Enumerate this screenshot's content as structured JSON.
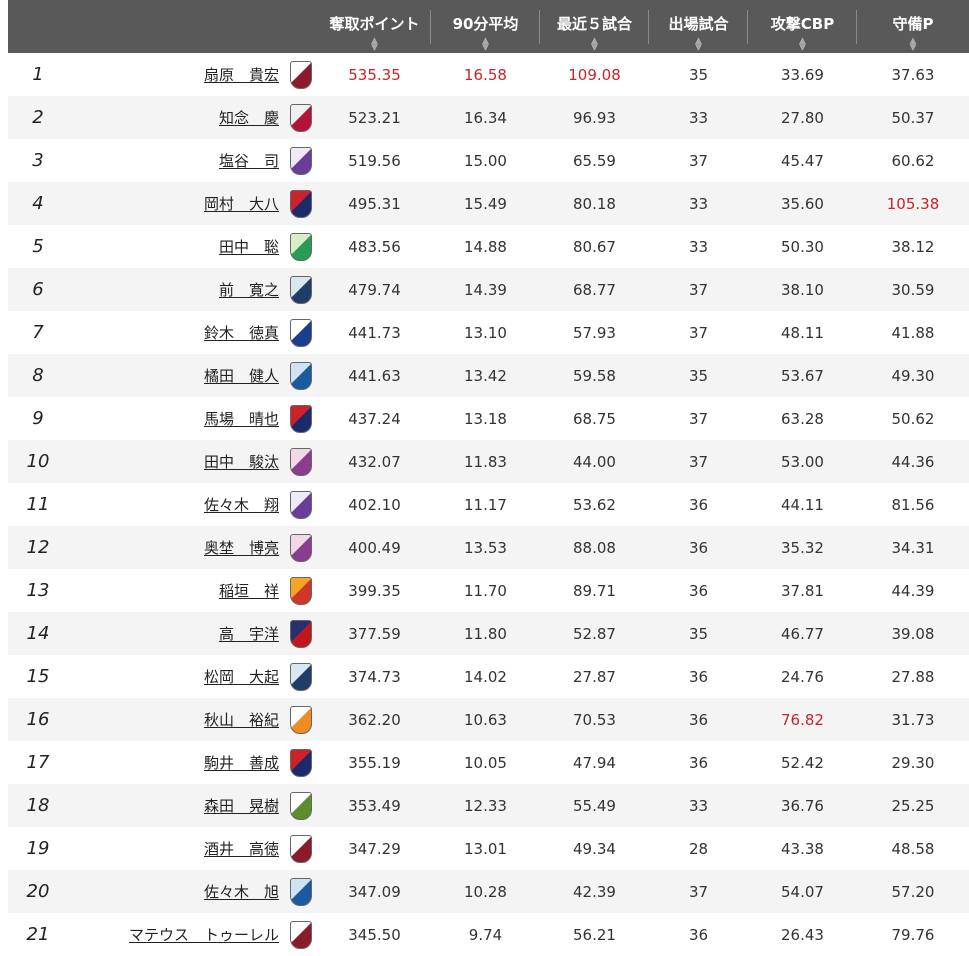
{
  "header": {
    "columns": [
      "奪取ポイント",
      "90分平均",
      "最近５試合",
      "出場試合",
      "攻撃CBP",
      "守備P"
    ],
    "sort_icon": "sort-arrows-icon"
  },
  "colors": {
    "header_bg": "#595959",
    "highlight": "#c8242b",
    "alt_row": "#f4f4f4"
  },
  "rows": [
    {
      "rank": "1",
      "name": "扇原　貴宏",
      "crest": "vissel",
      "v1": "535.35",
      "v2": "16.58",
      "v3": "109.08",
      "v4": "35",
      "v5": "33.69",
      "v6": "37.63"
    },
    {
      "rank": "2",
      "name": "知念　慶",
      "crest": "kashima",
      "v1": "523.21",
      "v2": "16.34",
      "v3": "96.93",
      "v4": "33",
      "v5": "27.80",
      "v6": "50.37"
    },
    {
      "rank": "3",
      "name": "塩谷　司",
      "crest": "hiroshima",
      "v1": "519.56",
      "v2": "15.00",
      "v3": "65.59",
      "v4": "37",
      "v5": "45.47",
      "v6": "60.62"
    },
    {
      "rank": "4",
      "name": "岡村　大八",
      "crest": "sapporo",
      "v1": "495.31",
      "v2": "15.49",
      "v3": "80.18",
      "v4": "33",
      "v5": "35.60",
      "v6": "105.38"
    },
    {
      "rank": "5",
      "name": "田中　聡",
      "crest": "shonan",
      "v1": "483.56",
      "v2": "14.88",
      "v3": "80.67",
      "v4": "33",
      "v5": "50.30",
      "v6": "38.12"
    },
    {
      "rank": "6",
      "name": "前　寛之",
      "crest": "fukuoka",
      "v1": "479.74",
      "v2": "14.39",
      "v3": "68.77",
      "v4": "37",
      "v5": "38.10",
      "v6": "30.59"
    },
    {
      "rank": "7",
      "name": "鈴木　徳真",
      "crest": "gamba",
      "v1": "441.73",
      "v2": "13.10",
      "v3": "57.93",
      "v4": "37",
      "v5": "48.11",
      "v6": "41.88"
    },
    {
      "rank": "8",
      "name": "橘田　健人",
      "crest": "kawasaki",
      "v1": "441.63",
      "v2": "13.42",
      "v3": "59.58",
      "v4": "35",
      "v5": "53.67",
      "v6": "49.30"
    },
    {
      "rank": "9",
      "name": "馬場　晴也",
      "crest": "sapporo",
      "v1": "437.24",
      "v2": "13.18",
      "v3": "68.75",
      "v4": "37",
      "v5": "63.28",
      "v6": "50.62"
    },
    {
      "rank": "10",
      "name": "田中　駿汰",
      "crest": "cerezo",
      "v1": "432.07",
      "v2": "11.83",
      "v3": "44.00",
      "v4": "37",
      "v5": "53.00",
      "v6": "44.36"
    },
    {
      "rank": "11",
      "name": "佐々木　翔",
      "crest": "hiroshima",
      "v1": "402.10",
      "v2": "11.17",
      "v3": "53.62",
      "v4": "36",
      "v5": "44.11",
      "v6": "81.56"
    },
    {
      "rank": "12",
      "name": "奥埜　博亮",
      "crest": "cerezo",
      "v1": "400.49",
      "v2": "13.53",
      "v3": "88.08",
      "v4": "36",
      "v5": "35.32",
      "v6": "34.31"
    },
    {
      "rank": "13",
      "name": "稲垣　祥",
      "crest": "nagoya",
      "v1": "399.35",
      "v2": "11.70",
      "v3": "89.71",
      "v4": "36",
      "v5": "37.81",
      "v6": "44.39"
    },
    {
      "rank": "14",
      "name": "高　宇洋",
      "crest": "tokyo",
      "v1": "377.59",
      "v2": "11.80",
      "v3": "52.87",
      "v4": "35",
      "v5": "46.77",
      "v6": "39.08"
    },
    {
      "rank": "15",
      "name": "松岡　大起",
      "crest": "fukuoka",
      "v1": "374.73",
      "v2": "14.02",
      "v3": "27.87",
      "v4": "36",
      "v5": "24.76",
      "v6": "27.88"
    },
    {
      "rank": "16",
      "name": "秋山　裕紀",
      "crest": "niigata",
      "v1": "362.20",
      "v2": "10.63",
      "v3": "70.53",
      "v4": "36",
      "v5": "76.82",
      "v6": "31.73"
    },
    {
      "rank": "17",
      "name": "駒井　善成",
      "crest": "sapporo",
      "v1": "355.19",
      "v2": "10.05",
      "v3": "47.94",
      "v4": "36",
      "v5": "52.42",
      "v6": "29.30"
    },
    {
      "rank": "18",
      "name": "森田　晃樹",
      "crest": "verdy",
      "v1": "353.49",
      "v2": "12.33",
      "v3": "55.49",
      "v4": "33",
      "v5": "36.76",
      "v6": "25.25"
    },
    {
      "rank": "19",
      "name": "酒井　高徳",
      "crest": "vissel",
      "v1": "347.29",
      "v2": "13.01",
      "v3": "49.34",
      "v4": "28",
      "v5": "43.38",
      "v6": "48.58"
    },
    {
      "rank": "20",
      "name": "佐々木　旭",
      "crest": "kawasaki",
      "v1": "347.09",
      "v2": "10.28",
      "v3": "42.39",
      "v4": "37",
      "v5": "54.07",
      "v6": "57.20"
    },
    {
      "rank": "21",
      "name": "マテウス　トゥーレル",
      "crest": "vissel",
      "v1": "345.50",
      "v2": "9.74",
      "v3": "56.21",
      "v4": "36",
      "v5": "26.43",
      "v6": "79.76"
    }
  ],
  "highlights": [
    {
      "row": 0,
      "col": "v1"
    },
    {
      "row": 0,
      "col": "v2"
    },
    {
      "row": 0,
      "col": "v3"
    },
    {
      "row": 3,
      "col": "v6"
    },
    {
      "row": 15,
      "col": "v5"
    }
  ]
}
